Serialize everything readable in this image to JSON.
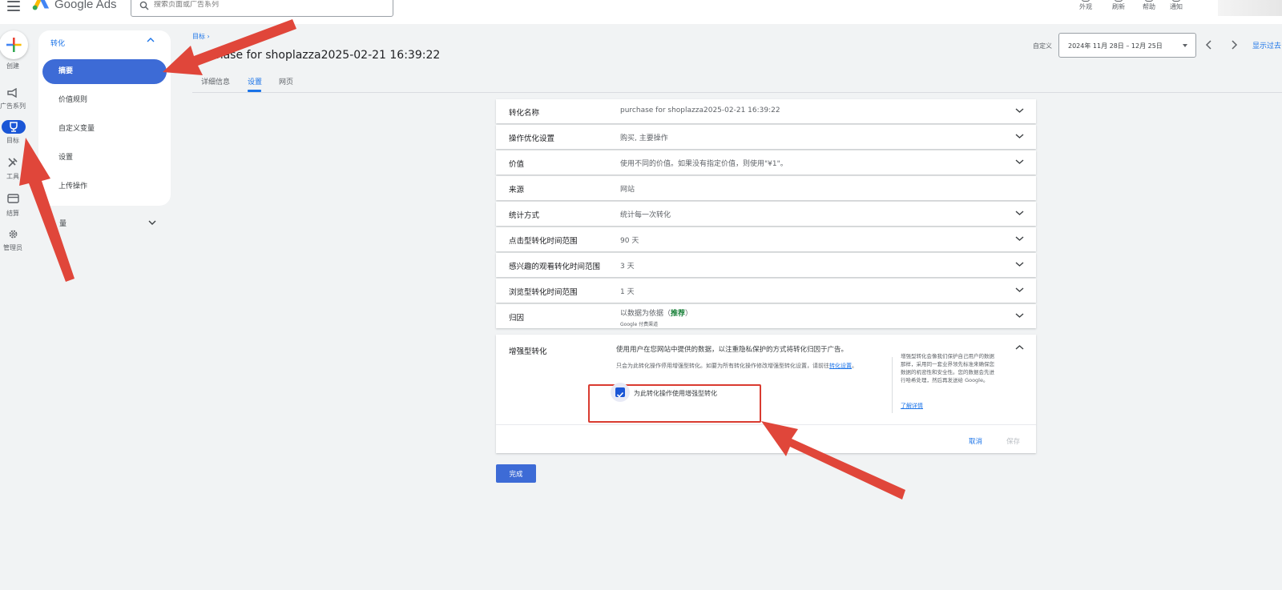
{
  "header": {
    "brand": "Google Ads",
    "search_placeholder": "搜索页面或广告系列",
    "toolbar": [
      {
        "label": "外观",
        "icon": "appearance-icon"
      },
      {
        "label": "刷新",
        "icon": "refresh-icon"
      },
      {
        "label": "帮助",
        "icon": "help-icon"
      },
      {
        "label": "通知",
        "icon": "notifications-icon"
      }
    ]
  },
  "rail": {
    "create": "创建",
    "campaigns": "广告系列",
    "goals": "目标",
    "tools": "工具",
    "billing": "结算",
    "admin": "管理员"
  },
  "subnav": {
    "section": "转化",
    "items": [
      "摘要",
      "价值规则",
      "自定义变量",
      "设置",
      "上传操作"
    ],
    "measurement": "量"
  },
  "page": {
    "breadcrumb": "目标 ›",
    "title": "chase for shoplazza2025-02-21 16:39:22",
    "tabs": [
      "详细信息",
      "设置",
      "网页"
    ],
    "active_tab": "设置"
  },
  "date": {
    "label": "自定义",
    "range": "2024年 11月 28日 – 12月 25日",
    "show_past": "显示过去"
  },
  "settings": [
    {
      "label": "转化名称",
      "value": "purchase for shoplazza2025-02-21 16:39:22"
    },
    {
      "label": "操作优化设置",
      "value": "购买, 主要操作"
    },
    {
      "label": "价值",
      "value": "使用不同的价值。如果没有指定价值，则使用\"¥1\"。"
    },
    {
      "label": "来源",
      "value": "网站"
    },
    {
      "label": "统计方式",
      "value": "统计每一次转化"
    },
    {
      "label": "点击型转化时间范围",
      "value": "90 天"
    },
    {
      "label": "感兴趣的观看转化时间范围",
      "value": "3 天"
    },
    {
      "label": "浏览型转化时间范围",
      "value": "1 天"
    },
    {
      "label": "归因",
      "value_prefix": "以数据为依据（",
      "recommended": "推荐",
      "value_suffix": "）",
      "sub": "Google 付费渠道"
    }
  ],
  "enhanced": {
    "label": "增强型转化",
    "description": "使用用户在您网站中提供的数据，以注重隐私保护的方式将转化归因于广告。",
    "note": "只会为此转化操作停用增强型转化。如要为所有转化操作修改增强型转化设置，请前往",
    "note_link": "转化设置",
    "note_end": "。",
    "checkbox_label": "为此转化操作使用增强型转化",
    "checked": true,
    "aside": "增强型转化会像我们保护自己用户的数据那样，采用同一套业界领先标准来确保您数据的机密性和安全性。您的数据会先进行哈希处理，然后再发送给 Google。",
    "learn_more": "了解详情",
    "cancel": "取消",
    "save": "保存"
  },
  "done": "完成",
  "colors": {
    "primary": "#3d6bd6",
    "link": "#1a73e8",
    "annotation": "#e0463a",
    "recommended": "#188038"
  }
}
